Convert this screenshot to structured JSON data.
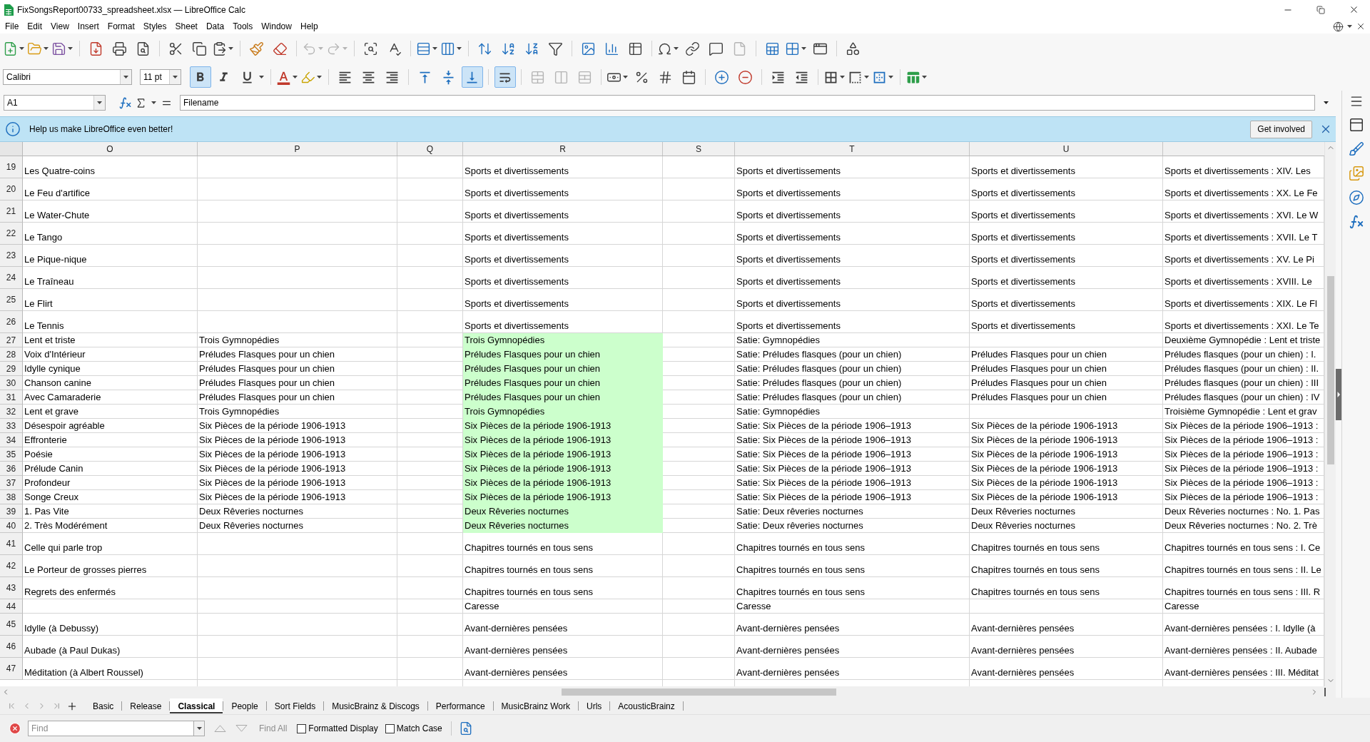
{
  "window": {
    "title": "FixSongsReport00733_spreadsheet.xlsx — LibreOffice Calc"
  },
  "menu": [
    "File",
    "Edit",
    "View",
    "Insert",
    "Format",
    "Styles",
    "Sheet",
    "Data",
    "Tools",
    "Window",
    "Help"
  ],
  "standard_toolbar": {
    "undo": {
      "disabled": true
    },
    "redo": {
      "disabled": true
    },
    "header_footer": {
      "disabled": true
    }
  },
  "format_toolbar": {
    "font_name": "Calibri",
    "font_size": "11 pt",
    "toggles": [
      {
        "active": true
      },
      {
        "active": false
      },
      {
        "active": false
      },
      {
        "active": false
      },
      {
        "active": false
      },
      {
        "active": false
      },
      {
        "active": false
      },
      {
        "active": false
      },
      {
        "active": true
      },
      {
        "active": true
      }
    ],
    "merge_buttons": [
      {
        "disabled": true
      },
      {
        "disabled": true
      },
      {
        "disabled": true
      }
    ]
  },
  "formula_bar": {
    "cell_reference": "A1",
    "content": "Filename"
  },
  "infobar": {
    "message": "Help us make LibreOffice even better!",
    "button": "Get involved"
  },
  "grid": {
    "columns": [
      "O",
      "P",
      "Q",
      "R",
      "S",
      "T",
      "U"
    ],
    "rows": [
      {
        "number": "19",
        "kind": "tall",
        "cells": [
          {
            "text": "Les Quatre-coins",
            "highlighted": false
          },
          null,
          null,
          {
            "text": "Sports et divertissements",
            "highlighted": false
          },
          null,
          {
            "text": "Sports et divertissements",
            "highlighted": false
          },
          {
            "text": "Sports et divertissements",
            "highlighted": false
          },
          {
            "text": "Sports et divertissements : XIV. Les",
            "highlighted": false
          }
        ]
      },
      {
        "number": "20",
        "kind": "tall",
        "cells": [
          {
            "text": "Le Feu d'artifice",
            "highlighted": false
          },
          null,
          null,
          {
            "text": "Sports et divertissements",
            "highlighted": false
          },
          null,
          {
            "text": "Sports et divertissements",
            "highlighted": false
          },
          {
            "text": "Sports et divertissements",
            "highlighted": false
          },
          {
            "text": "Sports et divertissements : XX. Le Fe",
            "highlighted": false
          }
        ]
      },
      {
        "number": "21",
        "kind": "tall",
        "cells": [
          {
            "text": "Le Water-Chute",
            "highlighted": false
          },
          null,
          null,
          {
            "text": "Sports et divertissements",
            "highlighted": false
          },
          null,
          {
            "text": "Sports et divertissements",
            "highlighted": false
          },
          {
            "text": "Sports et divertissements",
            "highlighted": false
          },
          {
            "text": "Sports et divertissements : XVI. Le W",
            "highlighted": false
          }
        ]
      },
      {
        "number": "22",
        "kind": "tall",
        "cells": [
          {
            "text": "Le Tango",
            "highlighted": false
          },
          null,
          null,
          {
            "text": "Sports et divertissements",
            "highlighted": false
          },
          null,
          {
            "text": "Sports et divertissements",
            "highlighted": false
          },
          {
            "text": "Sports et divertissements",
            "highlighted": false
          },
          {
            "text": "Sports et divertissements : XVII. Le T",
            "highlighted": false
          }
        ]
      },
      {
        "number": "23",
        "kind": "tall",
        "cells": [
          {
            "text": "Le Pique-nique",
            "highlighted": false
          },
          null,
          null,
          {
            "text": "Sports et divertissements",
            "highlighted": false
          },
          null,
          {
            "text": "Sports et divertissements",
            "highlighted": false
          },
          {
            "text": "Sports et divertissements",
            "highlighted": false
          },
          {
            "text": "Sports et divertissements : XV. Le Pi",
            "highlighted": false
          }
        ]
      },
      {
        "number": "24",
        "kind": "tall",
        "cells": [
          {
            "text": "Le Traîneau",
            "highlighted": false
          },
          null,
          null,
          {
            "text": "Sports et divertissements",
            "highlighted": false
          },
          null,
          {
            "text": "Sports et divertissements",
            "highlighted": false
          },
          {
            "text": "Sports et divertissements",
            "highlighted": false
          },
          {
            "text": "Sports et divertissements : XVIII. Le",
            "highlighted": false
          }
        ]
      },
      {
        "number": "25",
        "kind": "tall",
        "cells": [
          {
            "text": "Le Flirt",
            "highlighted": false
          },
          null,
          null,
          {
            "text": "Sports et divertissements",
            "highlighted": false
          },
          null,
          {
            "text": "Sports et divertissements",
            "highlighted": false
          },
          {
            "text": "Sports et divertissements",
            "highlighted": false
          },
          {
            "text": "Sports et divertissements : XIX. Le Fl",
            "highlighted": false
          }
        ]
      },
      {
        "number": "26",
        "kind": "tall",
        "cells": [
          {
            "text": "Le Tennis",
            "highlighted": false
          },
          null,
          null,
          {
            "text": "Sports et divertissements",
            "highlighted": false
          },
          null,
          {
            "text": "Sports et divertissements",
            "highlighted": false
          },
          {
            "text": "Sports et divertissements",
            "highlighted": false
          },
          {
            "text": "Sports et divertissements : XXI. Le Te",
            "highlighted": false
          }
        ]
      },
      {
        "number": "27",
        "kind": "short",
        "cells": [
          {
            "text": "Lent et triste",
            "highlighted": false
          },
          {
            "text": "Trois Gymnopédies",
            "highlighted": false
          },
          null,
          {
            "text": "Trois Gymnopédies",
            "highlighted": true
          },
          null,
          {
            "text": "Satie: Gymnopédies",
            "highlighted": false
          },
          null,
          {
            "text": "Deuxième Gymnopédie : Lent et triste",
            "highlighted": false
          }
        ]
      },
      {
        "number": "28",
        "kind": "short",
        "cells": [
          {
            "text": "Voix d'Intérieur",
            "highlighted": false
          },
          {
            "text": "Préludes Flasques pour un chien",
            "highlighted": false
          },
          null,
          {
            "text": "Préludes Flasques pour un chien",
            "highlighted": true
          },
          null,
          {
            "text": "Satie: Préludes flasques (pour un chien)",
            "highlighted": false
          },
          {
            "text": "Préludes Flasques pour un chien",
            "highlighted": false
          },
          {
            "text": "Préludes flasques (pour un chien) : I.",
            "highlighted": false
          }
        ]
      },
      {
        "number": "29",
        "kind": "short",
        "cells": [
          {
            "text": "Idylle cynique",
            "highlighted": false
          },
          {
            "text": "Préludes Flasques pour un chien",
            "highlighted": false
          },
          null,
          {
            "text": "Préludes Flasques pour un chien",
            "highlighted": true
          },
          null,
          {
            "text": "Satie: Préludes flasques (pour un chien)",
            "highlighted": false
          },
          {
            "text": "Préludes Flasques pour un chien",
            "highlighted": false
          },
          {
            "text": "Préludes flasques (pour un chien) : II.",
            "highlighted": false
          }
        ]
      },
      {
        "number": "30",
        "kind": "short",
        "cells": [
          {
            "text": "Chanson canine",
            "highlighted": false
          },
          {
            "text": "Préludes Flasques pour un chien",
            "highlighted": false
          },
          null,
          {
            "text": "Préludes Flasques pour un chien",
            "highlighted": true
          },
          null,
          {
            "text": "Satie: Préludes flasques (pour un chien)",
            "highlighted": false
          },
          {
            "text": "Préludes Flasques pour un chien",
            "highlighted": false
          },
          {
            "text": "Préludes flasques (pour un chien) : III",
            "highlighted": false
          }
        ]
      },
      {
        "number": "31",
        "kind": "short",
        "cells": [
          {
            "text": "Avec Camaraderie",
            "highlighted": false
          },
          {
            "text": "Préludes Flasques pour un chien",
            "highlighted": false
          },
          null,
          {
            "text": "Préludes Flasques pour un chien",
            "highlighted": true
          },
          null,
          {
            "text": "Satie: Préludes flasques (pour un chien)",
            "highlighted": false
          },
          {
            "text": "Préludes Flasques pour un chien",
            "highlighted": false
          },
          {
            "text": "Préludes flasques (pour un chien) : IV",
            "highlighted": false
          }
        ]
      },
      {
        "number": "32",
        "kind": "short",
        "cells": [
          {
            "text": "Lent et grave",
            "highlighted": false
          },
          {
            "text": "Trois Gymnopédies",
            "highlighted": false
          },
          null,
          {
            "text": "Trois Gymnopédies",
            "highlighted": true
          },
          null,
          {
            "text": "Satie: Gymnopédies",
            "highlighted": false
          },
          null,
          {
            "text": "Troisième Gymnopédie : Lent et grav",
            "highlighted": false
          }
        ]
      },
      {
        "number": "33",
        "kind": "short",
        "cells": [
          {
            "text": "Désespoir agréable",
            "highlighted": false
          },
          {
            "text": "Six Pièces de la période 1906-1913",
            "highlighted": false
          },
          null,
          {
            "text": "Six Pièces de la période 1906-1913",
            "highlighted": true
          },
          null,
          {
            "text": "Satie: Six Pièces de la période 1906–1913",
            "highlighted": false
          },
          {
            "text": "Six Pièces de la période 1906-1913",
            "highlighted": false
          },
          {
            "text": "Six Pièces de la période 1906–1913 :",
            "highlighted": false
          }
        ]
      },
      {
        "number": "34",
        "kind": "short",
        "cells": [
          {
            "text": "Effronterie",
            "highlighted": false
          },
          {
            "text": "Six Pièces de la période 1906-1913",
            "highlighted": false
          },
          null,
          {
            "text": "Six Pièces de la période 1906-1913",
            "highlighted": true
          },
          null,
          {
            "text": "Satie: Six Pièces de la période 1906–1913",
            "highlighted": false
          },
          {
            "text": "Six Pièces de la période 1906-1913",
            "highlighted": false
          },
          {
            "text": "Six Pièces de la période 1906–1913 :",
            "highlighted": false
          }
        ]
      },
      {
        "number": "35",
        "kind": "short",
        "cells": [
          {
            "text": "Poésie",
            "highlighted": false
          },
          {
            "text": "Six Pièces de la période 1906-1913",
            "highlighted": false
          },
          null,
          {
            "text": "Six Pièces de la période 1906-1913",
            "highlighted": true
          },
          null,
          {
            "text": "Satie: Six Pièces de la période 1906–1913",
            "highlighted": false
          },
          {
            "text": "Six Pièces de la période 1906-1913",
            "highlighted": false
          },
          {
            "text": "Six Pièces de la période 1906–1913 :",
            "highlighted": false
          }
        ]
      },
      {
        "number": "36",
        "kind": "short",
        "cells": [
          {
            "text": "Prélude Canin",
            "highlighted": false
          },
          {
            "text": "Six Pièces de la période 1906-1913",
            "highlighted": false
          },
          null,
          {
            "text": "Six Pièces de la période 1906-1913",
            "highlighted": true
          },
          null,
          {
            "text": "Satie: Six Pièces de la période 1906–1913",
            "highlighted": false
          },
          {
            "text": "Six Pièces de la période 1906-1913",
            "highlighted": false
          },
          {
            "text": "Six Pièces de la période 1906–1913 :",
            "highlighted": false
          }
        ]
      },
      {
        "number": "37",
        "kind": "short",
        "cells": [
          {
            "text": "Profondeur",
            "highlighted": false
          },
          {
            "text": "Six Pièces de la période 1906-1913",
            "highlighted": false
          },
          null,
          {
            "text": "Six Pièces de la période 1906-1913",
            "highlighted": true
          },
          null,
          {
            "text": "Satie: Six Pièces de la période 1906–1913",
            "highlighted": false
          },
          {
            "text": "Six Pièces de la période 1906-1913",
            "highlighted": false
          },
          {
            "text": "Six Pièces de la période 1906–1913 :",
            "highlighted": false
          }
        ]
      },
      {
        "number": "38",
        "kind": "short",
        "cells": [
          {
            "text": "Songe Creux",
            "highlighted": false
          },
          {
            "text": "Six Pièces de la période 1906-1913",
            "highlighted": false
          },
          null,
          {
            "text": "Six Pièces de la période 1906-1913",
            "highlighted": true
          },
          null,
          {
            "text": "Satie: Six Pièces de la période 1906–1913",
            "highlighted": false
          },
          {
            "text": "Six Pièces de la période 1906-1913",
            "highlighted": false
          },
          {
            "text": "Six Pièces de la période 1906–1913 :",
            "highlighted": false
          }
        ]
      },
      {
        "number": "39",
        "kind": "short",
        "cells": [
          {
            "text": "1. Pas Vite",
            "highlighted": false
          },
          {
            "text": "Deux Rêveries nocturnes",
            "highlighted": false
          },
          null,
          {
            "text": "Deux Rêveries nocturnes",
            "highlighted": true
          },
          null,
          {
            "text": "Satie: Deux rêveries nocturnes",
            "highlighted": false
          },
          {
            "text": "Deux Rêveries nocturnes",
            "highlighted": false
          },
          {
            "text": "Deux Rêveries nocturnes : No. 1. Pas",
            "highlighted": false
          }
        ]
      },
      {
        "number": "40",
        "kind": "short",
        "cells": [
          {
            "text": "2. Très Modérément",
            "highlighted": false
          },
          {
            "text": "Deux Rêveries nocturnes",
            "highlighted": false
          },
          null,
          {
            "text": "Deux Rêveries nocturnes",
            "highlighted": true
          },
          null,
          {
            "text": "Satie: Deux rêveries nocturnes",
            "highlighted": false
          },
          {
            "text": "Deux Rêveries nocturnes",
            "highlighted": false
          },
          {
            "text": "Deux Rêveries nocturnes : No. 2. Trè",
            "highlighted": false
          }
        ]
      },
      {
        "number": "41",
        "kind": "tall",
        "cells": [
          {
            "text": "Celle qui parle trop",
            "highlighted": false
          },
          null,
          null,
          {
            "text": "Chapitres tournés en tous sens",
            "highlighted": false
          },
          null,
          {
            "text": "Chapitres tournés en tous sens",
            "highlighted": false
          },
          {
            "text": "Chapitres tournés en tous sens",
            "highlighted": false
          },
          {
            "text": "Chapitres tournés en tous sens : I. Ce",
            "highlighted": false
          }
        ]
      },
      {
        "number": "42",
        "kind": "tall",
        "cells": [
          {
            "text": "Le Porteur de grosses pierres",
            "highlighted": false
          },
          null,
          null,
          {
            "text": "Chapitres tournés en tous sens",
            "highlighted": false
          },
          null,
          {
            "text": "Chapitres tournés en tous sens",
            "highlighted": false
          },
          {
            "text": "Chapitres tournés en tous sens",
            "highlighted": false
          },
          {
            "text": "Chapitres tournés en tous sens : II. Le",
            "highlighted": false
          }
        ]
      },
      {
        "number": "43",
        "kind": "tall",
        "cells": [
          {
            "text": "Regrets des enfermés",
            "highlighted": false
          },
          null,
          null,
          {
            "text": "Chapitres tournés en tous sens",
            "highlighted": false
          },
          null,
          {
            "text": "Chapitres tournés en tous sens",
            "highlighted": false
          },
          {
            "text": "Chapitres tournés en tous sens",
            "highlighted": false
          },
          {
            "text": "Chapitres tournés en tous sens : III. R",
            "highlighted": false
          }
        ]
      },
      {
        "number": "44",
        "kind": "short",
        "cells": [
          null,
          null,
          null,
          {
            "text": "Caresse",
            "highlighted": false
          },
          null,
          {
            "text": "Caresse",
            "highlighted": false
          },
          null,
          {
            "text": "Caresse",
            "highlighted": false
          }
        ]
      },
      {
        "number": "45",
        "kind": "tall",
        "cells": [
          {
            "text": "Idylle (à Debussy)",
            "highlighted": false
          },
          null,
          null,
          {
            "text": "Avant-dernières pensées",
            "highlighted": false
          },
          null,
          {
            "text": "Avant-dernières pensées",
            "highlighted": false
          },
          {
            "text": "Avant-dernières pensées",
            "highlighted": false
          },
          {
            "text": "Avant-dernières pensées : I. Idylle (à",
            "highlighted": false
          }
        ]
      },
      {
        "number": "46",
        "kind": "tall",
        "cells": [
          {
            "text": "Aubade (à Paul Dukas)",
            "highlighted": false
          },
          null,
          null,
          {
            "text": "Avant-dernières pensées",
            "highlighted": false
          },
          null,
          {
            "text": "Avant-dernières pensées",
            "highlighted": false
          },
          {
            "text": "Avant-dernières pensées",
            "highlighted": false
          },
          {
            "text": "Avant-dernières pensées : II. Aubade",
            "highlighted": false
          }
        ]
      },
      {
        "number": "47",
        "kind": "tall",
        "cells": [
          {
            "text": "Méditation (à Albert Roussel)",
            "highlighted": false
          },
          null,
          null,
          {
            "text": "Avant-dernières pensées",
            "highlighted": false
          },
          null,
          {
            "text": "Avant-dernières pensées",
            "highlighted": false
          },
          {
            "text": "Avant-dernières pensées",
            "highlighted": false
          },
          {
            "text": "Avant-dernières pensées : III. Méditat",
            "highlighted": false
          }
        ]
      }
    ]
  },
  "sheet_tabs": [
    {
      "label": "Basic",
      "selected": false
    },
    {
      "label": "Release",
      "selected": false
    },
    {
      "label": "Classical",
      "selected": true
    },
    {
      "label": "People",
      "selected": false
    },
    {
      "label": "Sort Fields",
      "selected": false
    },
    {
      "label": "MusicBrainz & Discogs",
      "selected": false
    },
    {
      "label": "Performance",
      "selected": false
    },
    {
      "label": "MusicBrainz Work",
      "selected": false
    },
    {
      "label": "Urls",
      "selected": false
    },
    {
      "label": "AcousticBrainz",
      "selected": false
    }
  ],
  "find_bar": {
    "placeholder": "Find",
    "search_arrows": {
      "disabled": true
    },
    "find_all": {
      "label": "Find All",
      "disabled": true
    },
    "options": [
      {
        "label": "Formatted Display",
        "checked": false
      },
      {
        "label": "Match Case",
        "checked": false
      }
    ]
  }
}
